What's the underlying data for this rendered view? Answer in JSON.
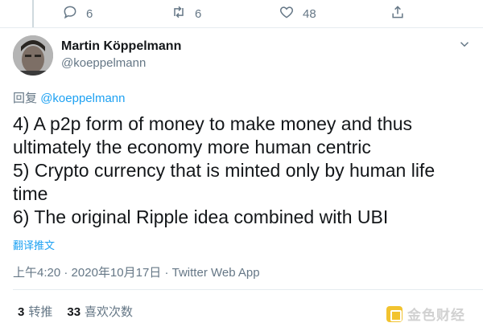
{
  "actions": {
    "reply_count": "6",
    "retweet_count": "6",
    "like_count": "48"
  },
  "author": {
    "name": "Martin Köppelmann",
    "handle": "@koeppelmann"
  },
  "reply_to": {
    "prefix": "回复",
    "mention": "@koeppelmann"
  },
  "tweet": {
    "lines": [
      "4) A p2p form of money to make money and thus ultimately the economy more human centric",
      "5) Crypto currency that is minted only by human life time",
      "6) The original Ripple idea combined with UBI"
    ]
  },
  "translate_label": "翻译推文",
  "meta": {
    "time": "上午4:20",
    "separator1": " · ",
    "date": "2020年10月17日",
    "separator2": " · ",
    "source": "Twitter Web App"
  },
  "stats": {
    "retweets_value": "3",
    "retweets_label": "转推",
    "likes_value": "33",
    "likes_label": "喜欢次数"
  },
  "watermark": {
    "text": "金色财经"
  },
  "icons": {
    "reply": "reply-icon",
    "retweet": "retweet-icon",
    "like": "heart-icon",
    "share": "share-icon",
    "more": "chevron-down-icon"
  },
  "colors": {
    "link": "#1da1f2",
    "secondary": "#657786",
    "primary_text": "#14171a",
    "watermark_logo": "#f0b90b"
  }
}
